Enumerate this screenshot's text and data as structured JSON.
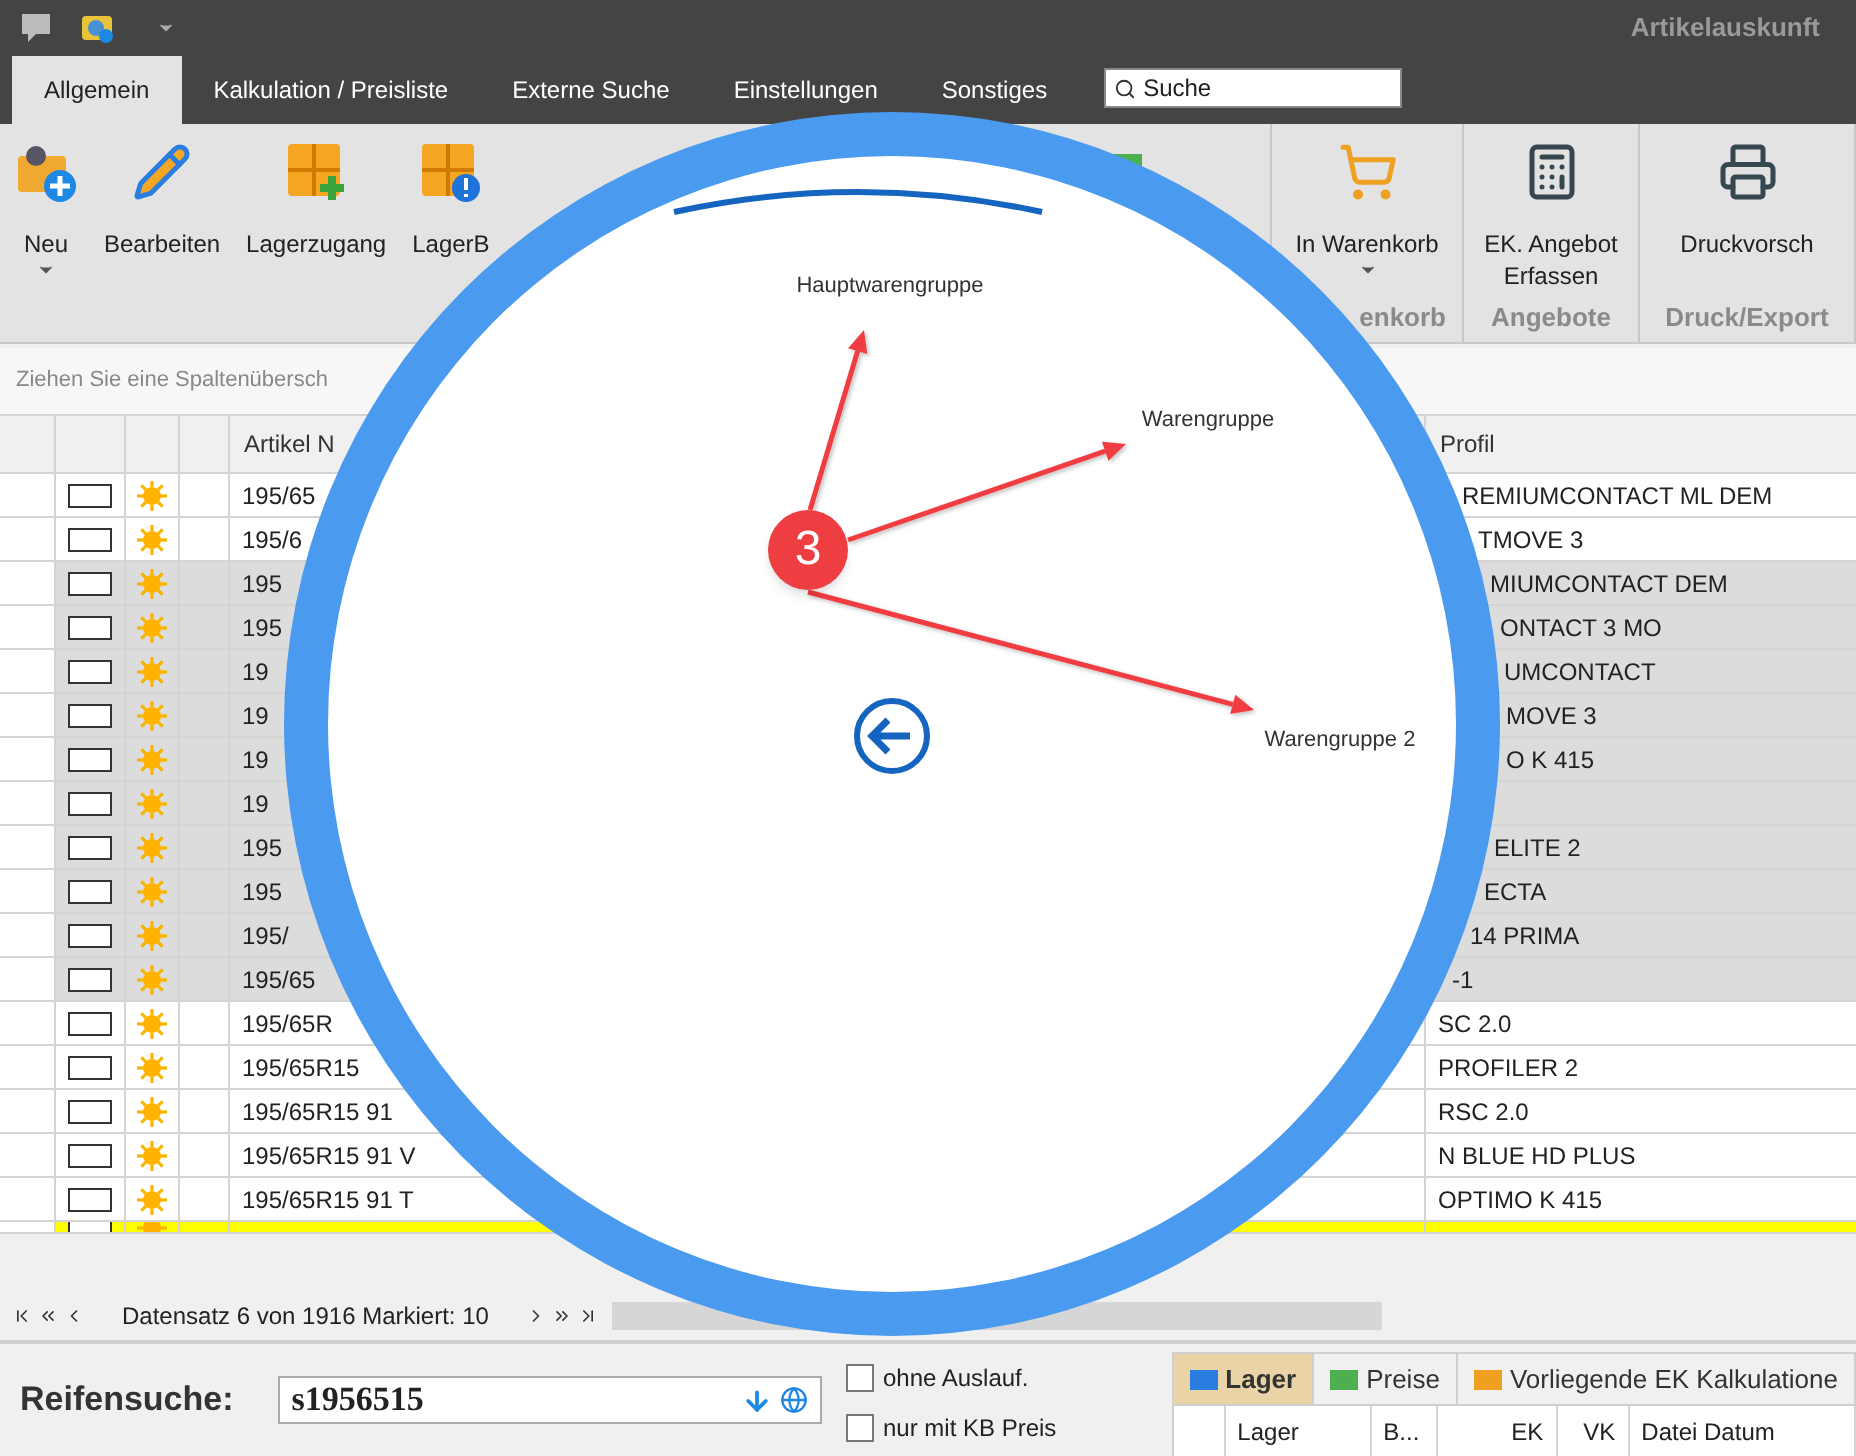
{
  "title_bar": {
    "title": "Artikelauskunft"
  },
  "tabs": [
    {
      "label": "Allgemein",
      "selected": true
    },
    {
      "label": "Kalkulation / Preisliste",
      "selected": false
    },
    {
      "label": "Externe Suche",
      "selected": false
    },
    {
      "label": "Einstellungen",
      "selected": false
    },
    {
      "label": "Sonstiges",
      "selected": false
    }
  ],
  "search": {
    "placeholder": "Suche"
  },
  "ribbon": {
    "groups": [
      {
        "buttons": [
          {
            "label": "Neu",
            "dropdown": true
          },
          {
            "label": "Bearbeiten",
            "dropdown": false
          },
          {
            "label": "Lagerzugang",
            "dropdown": false
          },
          {
            "label": "LagerB",
            "dropdown": false
          }
        ]
      },
      {
        "label": "enkorb",
        "buttons": [
          {
            "label": "In Warenkorb",
            "dropdown": true
          }
        ]
      },
      {
        "label": "Angebote",
        "buttons": [
          {
            "label": "EK. Angebot Erfassen",
            "dropdown": false
          }
        ]
      },
      {
        "label": "Druck/Export",
        "buttons": [
          {
            "label": "Druckvorsch",
            "dropdown": false
          }
        ]
      }
    ]
  },
  "grid": {
    "group_panel": "Ziehen Sie eine Spaltenübersch",
    "columns": [
      "Artikel N",
      "Profil"
    ],
    "rows": [
      {
        "article": "195/65",
        "profile": "REMIUMCONTACT ML DEM",
        "selected": false,
        "checked": false,
        "focused": false
      },
      {
        "article": "195/6",
        "profile": "TMOVE 3",
        "selected": false,
        "checked": false,
        "focused": false
      },
      {
        "article": "195",
        "profile": "MIUMCONTACT DEM",
        "selected": true,
        "checked": false,
        "focused": false
      },
      {
        "article": "195",
        "profile": "ONTACT 3 MO",
        "selected": true,
        "checked": false,
        "focused": false
      },
      {
        "article": "19",
        "profile": "UMCONTACT",
        "selected": true,
        "checked": false,
        "focused": false
      },
      {
        "article": "19",
        "profile": "MOVE 3",
        "selected": true,
        "checked": false,
        "focused": false
      },
      {
        "article": "19",
        "profile": "O K 415",
        "selected": true,
        "checked": false,
        "focused": false
      },
      {
        "article": "19",
        "selected": true,
        "checked": false,
        "focused": false
      },
      {
        "article": "195",
        "profile": "ELITE 2",
        "selected": true,
        "checked": false,
        "focused": false
      },
      {
        "article": "195",
        "profile": "ECTA",
        "selected": true,
        "checked": false,
        "focused": false
      },
      {
        "article": "195/",
        "profile": "14 PRIMA",
        "selected": true,
        "checked": false,
        "focused": false
      },
      {
        "article": "195/65",
        "profile": "-1",
        "selected": true,
        "checked": false,
        "focused": false
      },
      {
        "article": "195/65R",
        "profile": "SC 2.0",
        "selected": false,
        "checked": false,
        "focused": false
      },
      {
        "article": "195/65R15",
        "profile": "PROFILER 2",
        "selected": false,
        "checked": false,
        "focused": false
      },
      {
        "article": "195/65R15 91",
        "profile": "RSC 2.0",
        "selected": false,
        "checked": false,
        "focused": false
      },
      {
        "article": "195/65R15 91 V",
        "profile": "N BLUE HD PLUS",
        "selected": false,
        "checked": false,
        "focused": false
      },
      {
        "article": "195/65R15 91 T",
        "profile": "OPTIMO K 415",
        "selected": false,
        "checked": false,
        "focused": false
      },
      {
        "selected": false,
        "checked": false,
        "focused": true
      }
    ],
    "navigator": "Datensatz 6 von 1916 Markiert: 10"
  },
  "tire_search": {
    "label": "Reifensuche:",
    "value": "s1956515",
    "options": [
      {
        "label": "ohne Auslauf.",
        "checked": false
      },
      {
        "label": "nur mit KB Preis",
        "checked": false
      }
    ]
  },
  "detail": {
    "tabs": [
      {
        "label": "Lager",
        "selected": true
      },
      {
        "label": "Preise",
        "selected": false
      },
      {
        "label": "Vorliegende EK Kalkulatione",
        "selected": false
      }
    ],
    "columns": [
      {
        "label": "Lager",
        "kind": "text"
      },
      {
        "label": "B...",
        "kind": "text"
      },
      {
        "label": "EK",
        "kind": "number"
      },
      {
        "label": "VK",
        "kind": "number"
      },
      {
        "label": "Datei Datum",
        "kind": "text"
      }
    ]
  },
  "radial_menu": {
    "badge": "3",
    "items": [
      {
        "label": "Hauptwarengruppe"
      },
      {
        "label": "Warengruppe"
      },
      {
        "label": "Warengruppe 2"
      }
    ]
  }
}
